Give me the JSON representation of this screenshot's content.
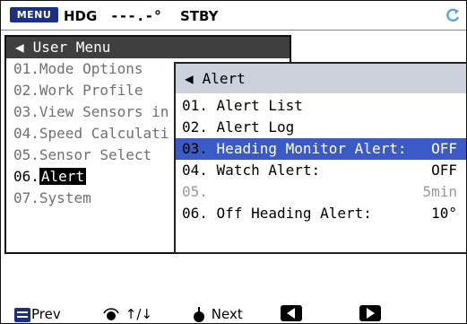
{
  "status": {
    "menu_badge": "MENU",
    "hdg_label": "HDG",
    "hdg_value": "---.-°",
    "mode": "STBY"
  },
  "user_menu": {
    "title": "User Menu",
    "items": [
      {
        "num": "01.",
        "label": "Mode Options"
      },
      {
        "num": "02.",
        "label": "Work Profile"
      },
      {
        "num": "03.",
        "label": "View Sensors in"
      },
      {
        "num": "04.",
        "label": "Speed Calculati"
      },
      {
        "num": "05.",
        "label": "Sensor Select"
      },
      {
        "num": "06.",
        "label": "Alert"
      },
      {
        "num": "07.",
        "label": "System"
      }
    ]
  },
  "alert_menu": {
    "title": "Alert",
    "items": [
      {
        "num": "01.",
        "label": "Alert List",
        "value": ""
      },
      {
        "num": "02.",
        "label": "Alert Log",
        "value": ""
      },
      {
        "num": "03.",
        "label": "Heading Monitor Alert:",
        "value": "OFF"
      },
      {
        "num": "04.",
        "label": "Watch Alert:",
        "value": "OFF"
      },
      {
        "num": "05.",
        "label": "",
        "value": "5min"
      },
      {
        "num": "06.",
        "label": "Off Heading Alert:",
        "value": "10°"
      }
    ]
  },
  "bottom_bar": {
    "prev": "Prev",
    "updown": "↑/↓",
    "next": "Next"
  },
  "colors": {
    "accent_blue": "#3a5bc7",
    "menu_badge": "#1b2f85",
    "title_dark": "#3f3f3f",
    "alert_title": "#ccd1dc"
  }
}
